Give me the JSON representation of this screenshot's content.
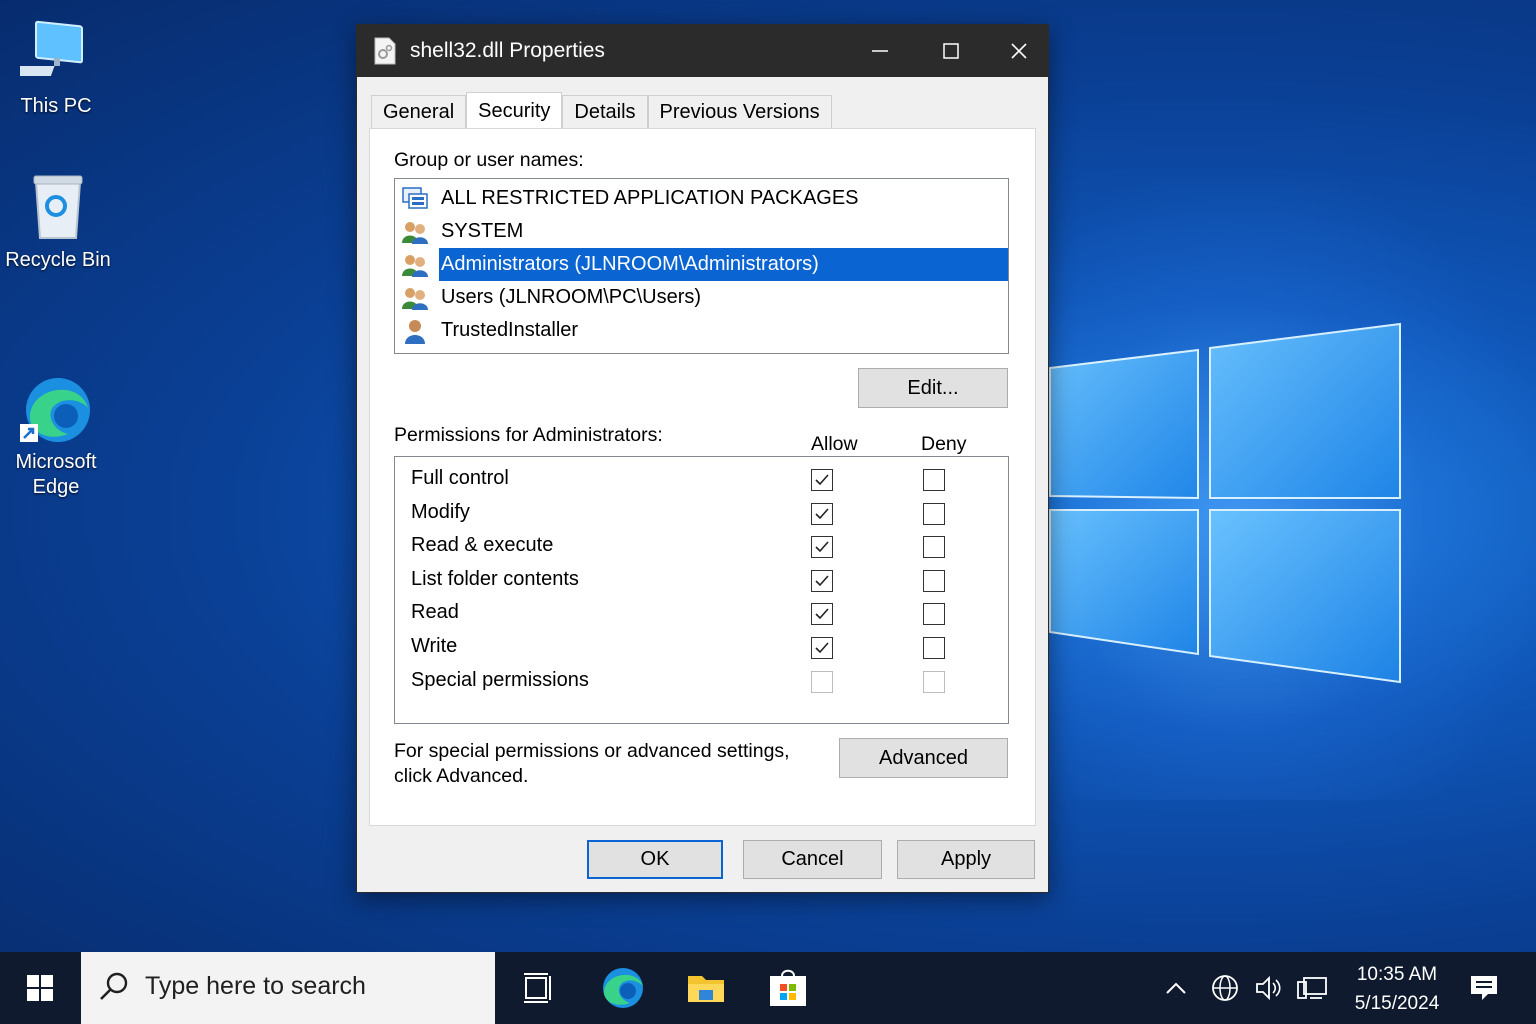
{
  "desktop": {
    "icons": [
      {
        "label": "This PC"
      },
      {
        "label": "Recycle Bin"
      },
      {
        "label": "Microsoft\nEdge"
      }
    ]
  },
  "dialog": {
    "title": "shell32.dll Properties",
    "tabs": [
      "General",
      "Security",
      "Details",
      "Previous Versions"
    ],
    "active_tab": "Security",
    "group_label": "Group or user names:",
    "users": [
      {
        "name": "ALL RESTRICTED APPLICATION PACKAGES",
        "icon": "package-group-icon",
        "selected": false
      },
      {
        "name": "SYSTEM",
        "icon": "users-group-icon",
        "selected": false
      },
      {
        "name": "Administrators (JLNROOM\\Administrators)",
        "icon": "users-group-icon",
        "selected": true
      },
      {
        "name": "Users (JLNROOM\\PC\\Users)",
        "icon": "users-group-icon",
        "selected": false
      },
      {
        "name": "TrustedInstaller",
        "icon": "user-icon",
        "selected": false
      }
    ],
    "edit_label": "Edit...",
    "permissions_label": "Permissions for Administrators:",
    "allow_header": "Allow",
    "deny_header": "Deny",
    "permissions": [
      {
        "name": "Full control",
        "allow": true,
        "deny": false,
        "disabled": false
      },
      {
        "name": "Modify",
        "allow": true,
        "deny": false,
        "disabled": false
      },
      {
        "name": "Read & execute",
        "allow": true,
        "deny": false,
        "disabled": false
      },
      {
        "name": "List folder contents",
        "allow": true,
        "deny": false,
        "disabled": false
      },
      {
        "name": "Read",
        "allow": true,
        "deny": false,
        "disabled": false
      },
      {
        "name": "Write",
        "allow": true,
        "deny": false,
        "disabled": false
      },
      {
        "name": "Special permissions",
        "allow": false,
        "deny": false,
        "disabled": true
      }
    ],
    "advanced_hint_line1": "For special permissions or advanced settings,",
    "advanced_hint_line2": "click Advanced.",
    "advanced_label": "Advanced",
    "ok_label": "OK",
    "cancel_label": "Cancel",
    "apply_label": "Apply"
  },
  "taskbar": {
    "search_placeholder": "Type here to search",
    "time": "10:35 AM",
    "date": "5/15/2024"
  },
  "colors": {
    "selection": "#0a64d2",
    "titlebar": "#2b2b2b",
    "taskbar": "#0f1a2e"
  }
}
